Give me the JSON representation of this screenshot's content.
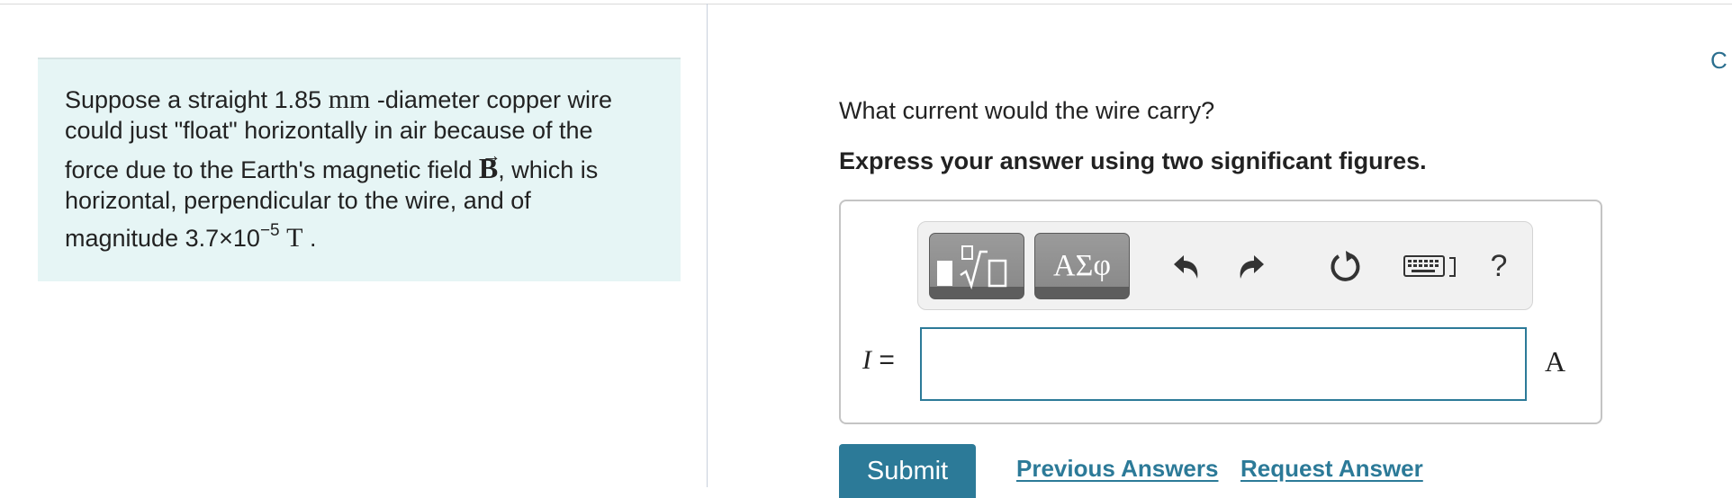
{
  "problem": {
    "line1_pre": "Suppose a straight 1.85 ",
    "line1_unit": "mm",
    "line1_post": " -diameter copper wire",
    "line2": "could just \"float\" horizontally in air because of the",
    "line3_pre": "force due to the Earth's magnetic field ",
    "field_symbol": "B",
    "field_arrow": "→",
    "line3_post": ", which is",
    "line4": "horizontal, perpendicular to the wire, and of",
    "line5_pre": "magnitude 3.7×10",
    "exponent": "−5",
    "magnitude_unit": "T",
    "line5_post": " ."
  },
  "corner_text": "C",
  "question": {
    "prompt": "What current would the wire carry?",
    "instruction": "Express your answer using two significant figures."
  },
  "toolbar": {
    "symbols_label": "ΑΣφ",
    "help_label": "?",
    "icons": [
      "templates-icon",
      "undo-icon",
      "redo-icon",
      "reset-icon",
      "keyboard-icon",
      "help-icon"
    ]
  },
  "answer": {
    "variable": "I",
    "equals": " =",
    "value": "",
    "unit": "A"
  },
  "actions": {
    "submit_label": "Submit",
    "previous_label": "Previous Answers",
    "request_label": "Request Answer"
  },
  "colors": {
    "accent": "#2c7a98",
    "problem_background": "#e6f5f5",
    "toolbar_button": "#8a8a8a"
  }
}
